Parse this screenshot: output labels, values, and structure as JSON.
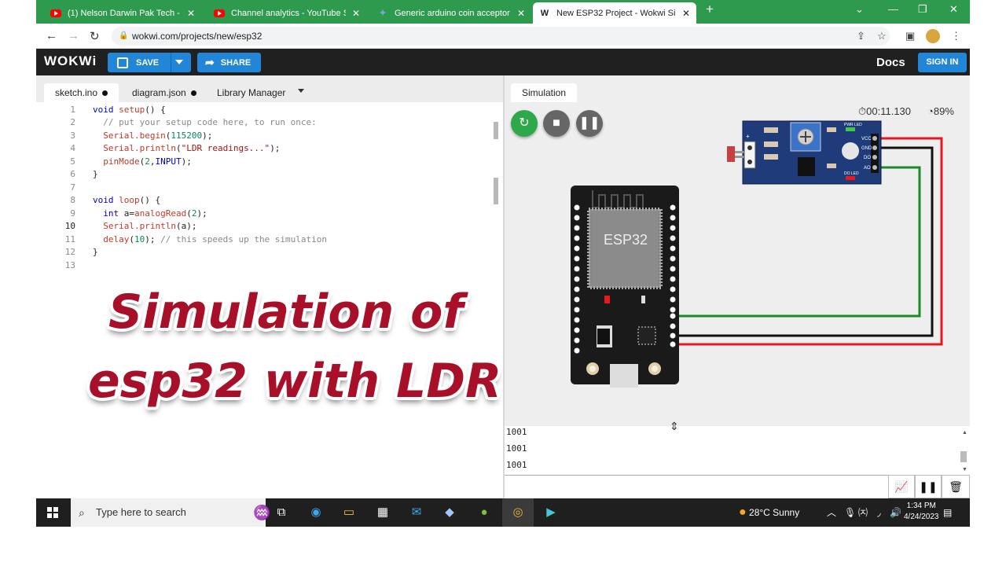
{
  "browser": {
    "tabs": [
      {
        "title": "(1) Nelson Darwin Pak Tech - You",
        "icon": "youtube-icon"
      },
      {
        "title": "Channel analytics - YouTube Stud",
        "icon": "youtube-icon"
      },
      {
        "title": "Generic arduino coin acceptor la",
        "icon": "page-icon"
      },
      {
        "title": "New ESP32 Project - Wokwi Simu",
        "icon": "wokwi-icon"
      }
    ],
    "url": "wokwi.com/projects/new/esp32"
  },
  "header": {
    "logo": "WOKWi",
    "save_label": "SAVE",
    "share_label": "SHARE",
    "docs_label": "Docs",
    "signin_label": "SIGN IN"
  },
  "editor": {
    "tabs": [
      "sketch.ino",
      "diagram.json",
      "Library Manager"
    ],
    "line_numbers": [
      "1",
      "2",
      "3",
      "4",
      "5",
      "6",
      "7",
      "8",
      "9",
      "10",
      "11",
      "12",
      "13"
    ]
  },
  "overlay": {
    "line1": "Simulation of",
    "line2": "esp32 with LDR"
  },
  "simulation": {
    "tab_label": "Simulation",
    "time": "00:11.130",
    "performance": "89%",
    "chip_label": "ESP32",
    "ldr_labels": {
      "vcc": "VCC",
      "gnd": "GND",
      "do": "DO",
      "ao": "AO",
      "pwr": "PWR LED",
      "dol": "DO LED"
    }
  },
  "serial": {
    "lines": [
      "1001",
      "1001",
      "1001"
    ]
  },
  "taskbar": {
    "search_placeholder": "Type here to search",
    "weather": "28°C  Sunny",
    "time": "1:34 PM",
    "date": "4/24/2023"
  }
}
